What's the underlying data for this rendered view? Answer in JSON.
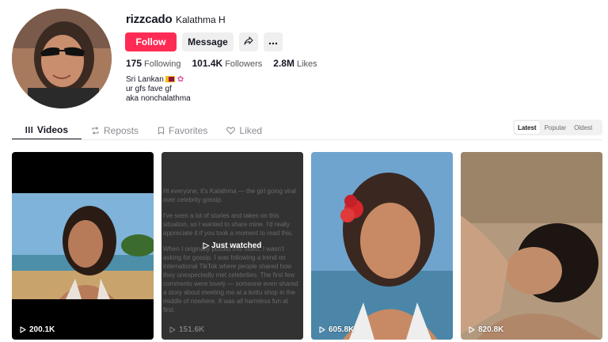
{
  "profile": {
    "username": "rizzcado",
    "nickname": "Kalathma H",
    "follow_label": "Follow",
    "message_label": "Message",
    "share_icon": "share-icon",
    "more_icon": "more-icon",
    "stats": [
      {
        "num": "175",
        "label": "Following"
      },
      {
        "num": "101.4K",
        "label": "Followers"
      },
      {
        "num": "2.8M",
        "label": "Likes"
      }
    ],
    "bio": {
      "line1": "Sri Lankan",
      "line2": "ur gfs fave gf",
      "line3": "aka nonchalathma"
    }
  },
  "tabs": [
    {
      "label": "Videos",
      "icon": "grid-icon",
      "active": true
    },
    {
      "label": "Reposts",
      "icon": "repost-icon",
      "active": false
    },
    {
      "label": "Favorites",
      "icon": "bookmark-icon",
      "active": false
    },
    {
      "label": "Liked",
      "icon": "heart-icon",
      "active": false
    }
  ],
  "sort": [
    {
      "label": "Latest",
      "active": true
    },
    {
      "label": "Popular",
      "active": false
    },
    {
      "label": "Oldest",
      "active": false
    }
  ],
  "videos": [
    {
      "views": "200.1K"
    },
    {
      "views": "151.6K",
      "just_watched": "Just watched",
      "overlay_paragraphs": [
        "Hi everyone, it's Kalathma — the girl going viral over celebrity gossip.",
        "I've seen a lot of stories and takes on this situation, so I wanted to share mine. I'd really appreciate it if you took a moment to read this.",
        "When I originally posted this video, I wasn't asking for gossip. I was following a trend on international TikTok where people shared how they unexpectedly met celebrities. The first few comments were lovely — someone even shared a story about meeting me at a kottu shop in the middle of nowhere. It was all harmless fun at first."
      ]
    },
    {
      "views": "605.8K"
    },
    {
      "views": "820.8K"
    }
  ],
  "colors": {
    "accent": "#fe2c55",
    "text": "#161823",
    "muted": "#8a8b91",
    "button_bg": "#efefef"
  }
}
